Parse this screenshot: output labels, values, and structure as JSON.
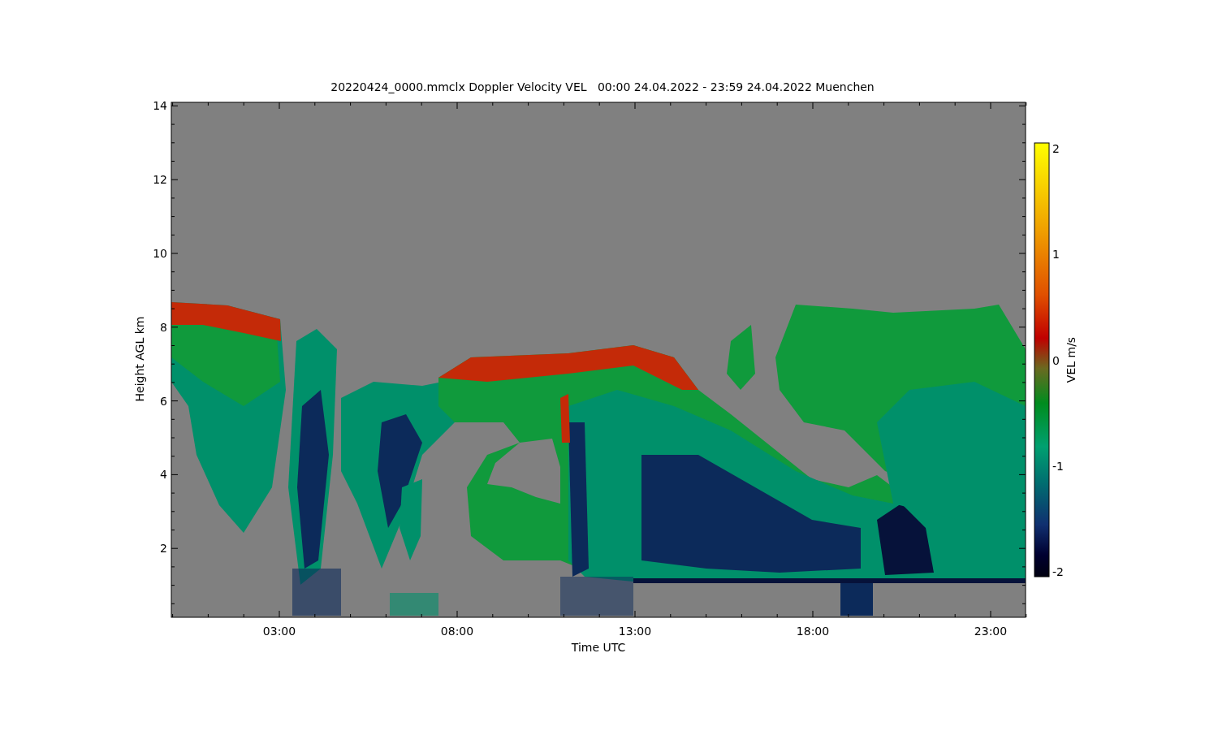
{
  "title": "20220424_0000.mmclx Doppler Velocity VEL   00:00 24.04.2022 - 23:59 24.04.2022 Muenchen",
  "xlabel": "Time UTC",
  "ylabel": "Height AGL km",
  "xticks": [
    "03:00",
    "08:00",
    "13:00",
    "18:00",
    "23:00"
  ],
  "yticks": [
    "14",
    "12",
    "10",
    "8",
    "6",
    "4",
    "2"
  ],
  "colorbar": {
    "label": "VEL m/s",
    "ticks": [
      "2",
      "1",
      "0",
      "-1",
      "-2"
    ]
  }
}
